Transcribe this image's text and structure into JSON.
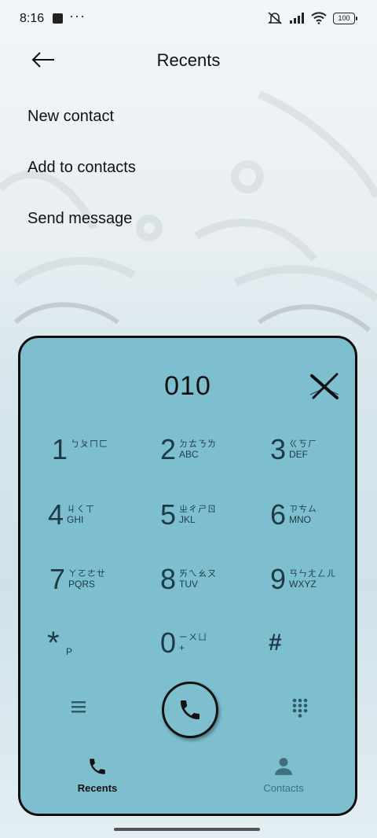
{
  "status": {
    "time": "8:16",
    "dots": "···",
    "battery": "100"
  },
  "header": {
    "title": "Recents"
  },
  "menu": {
    "items": [
      "New contact",
      "Add to contacts",
      "Send message"
    ]
  },
  "dialer": {
    "number": "010",
    "keys": [
      {
        "digit": "1",
        "sub1": "ㄅㄆㄇㄈ",
        "sub2": ""
      },
      {
        "digit": "2",
        "sub1": "ㄉㄊㄋㄌ",
        "sub2": "ABC"
      },
      {
        "digit": "3",
        "sub1": "ㄍㄎㄏ",
        "sub2": "DEF"
      },
      {
        "digit": "4",
        "sub1": "ㄐㄑㄒ",
        "sub2": "GHI"
      },
      {
        "digit": "5",
        "sub1": "ㄓㄔㄕㄖ",
        "sub2": "JKL"
      },
      {
        "digit": "6",
        "sub1": "ㄗㄘㄙ",
        "sub2": "MNO"
      },
      {
        "digit": "7",
        "sub1": "ㄚㄛㄜㄝ",
        "sub2": "PQRS"
      },
      {
        "digit": "8",
        "sub1": "ㄞㄟㄠㄡ",
        "sub2": "TUV"
      },
      {
        "digit": "9",
        "sub1": "ㄢㄣㄤㄥㄦ",
        "sub2": "WXYZ"
      },
      {
        "digit": "*",
        "sub1": "",
        "sub2": "P"
      },
      {
        "digit": "0",
        "sub1": "ㄧㄨㄩ",
        "sub2": "+"
      },
      {
        "digit": "#",
        "sub1": "",
        "sub2": ""
      }
    ]
  },
  "nav": {
    "tabs": [
      {
        "label": "Recents",
        "icon": "phone-icon",
        "active": true
      },
      {
        "label": "Contacts",
        "icon": "person-icon",
        "active": false
      }
    ]
  },
  "colors": {
    "dialer_bg": "#7dbfcf",
    "key_text": "#1e3a44",
    "inactive_tab": "#3f6f7c"
  }
}
